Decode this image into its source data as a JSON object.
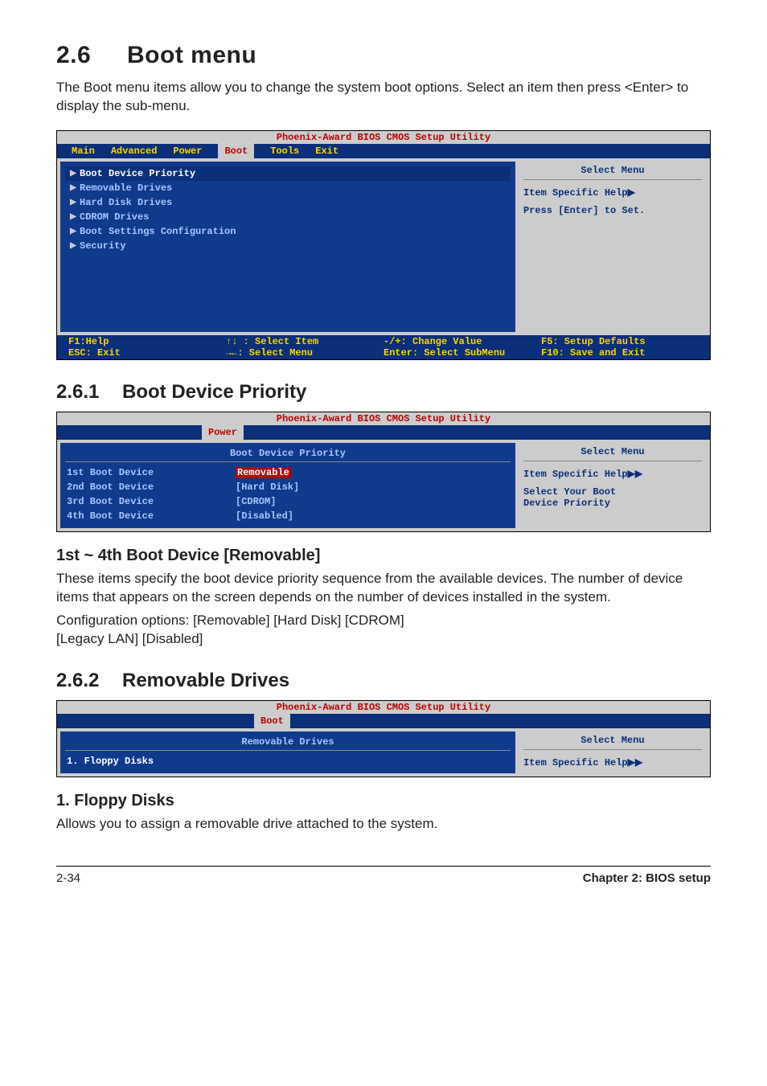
{
  "section": {
    "number": "2.6",
    "title": "Boot menu"
  },
  "intro": "The Boot menu items allow you to change the system boot options. Select an item then press <Enter> to display the sub-menu.",
  "bios_main": {
    "titlebar": "Phoenix-Award BIOS CMOS Setup Utility",
    "tabs": [
      "Main",
      "Advanced",
      "Power",
      "Boot",
      "Tools",
      "Exit"
    ],
    "active_tab": "Boot",
    "menu": [
      "Boot Device Priority",
      "Removable Drives",
      "Hard Disk Drives",
      "CDROM Drives",
      "Boot Settings Configuration",
      "Security"
    ],
    "help": {
      "select_menu": "Select Menu",
      "line1": "Item Specific Help",
      "line2": "Press [Enter] to Set."
    },
    "footer": {
      "c1a": "F1:Help",
      "c1b": "ESC: Exit",
      "c2a": "↑↓ : Select Item",
      "c2b": "→←: Select Menu",
      "c3a": "-/+: Change Value",
      "c3b": "Enter: Select SubMenu",
      "c4a": "F5: Setup Defaults",
      "c4b": "F10: Save and Exit"
    }
  },
  "sub1": {
    "number": "2.6.1",
    "title": "Boot Device Priority"
  },
  "bios_priority": {
    "titlebar": "Phoenix-Award BIOS CMOS Setup Utility",
    "active_tab": "Power",
    "subheader": "Boot Device Priority",
    "rows": [
      {
        "label": "1st Boot Device",
        "value": "Removable",
        "highlight": true
      },
      {
        "label": "2nd Boot Device",
        "value": "[Hard Disk]"
      },
      {
        "label": "3rd Boot Device",
        "value": "[CDROM]"
      },
      {
        "label": "4th Boot Device",
        "value": "[Disabled]"
      }
    ],
    "help": {
      "select_menu": "Select Menu",
      "line1": "Item Specific Help",
      "line2": "Select Your Boot",
      "line3": "Device Priority"
    }
  },
  "item1": {
    "heading": "1st ~ 4th Boot Device [Removable]",
    "p1": "These items specify the boot device priority sequence from the available devices. The number of device items that appears on the screen depends on the number of devices installed in the system.",
    "p2": "Configuration options: [Removable] [Hard Disk] [CDROM]",
    "p3": "[Legacy LAN] [Disabled]"
  },
  "sub2": {
    "number": "2.6.2",
    "title": "Removable Drives"
  },
  "bios_removable": {
    "titlebar": "Phoenix-Award BIOS CMOS Setup Utility",
    "active_tab": "Boot",
    "subheader": "Removable Drives",
    "row_label": "1. Floppy Disks",
    "help": {
      "select_menu": "Select Menu",
      "line1": "Item Specific Help"
    }
  },
  "item2": {
    "heading": "1. Floppy Disks",
    "p1": "Allows you to assign a removable drive attached to the system."
  },
  "footer": {
    "page": "2-34",
    "chapter": "Chapter 2: BIOS setup"
  }
}
